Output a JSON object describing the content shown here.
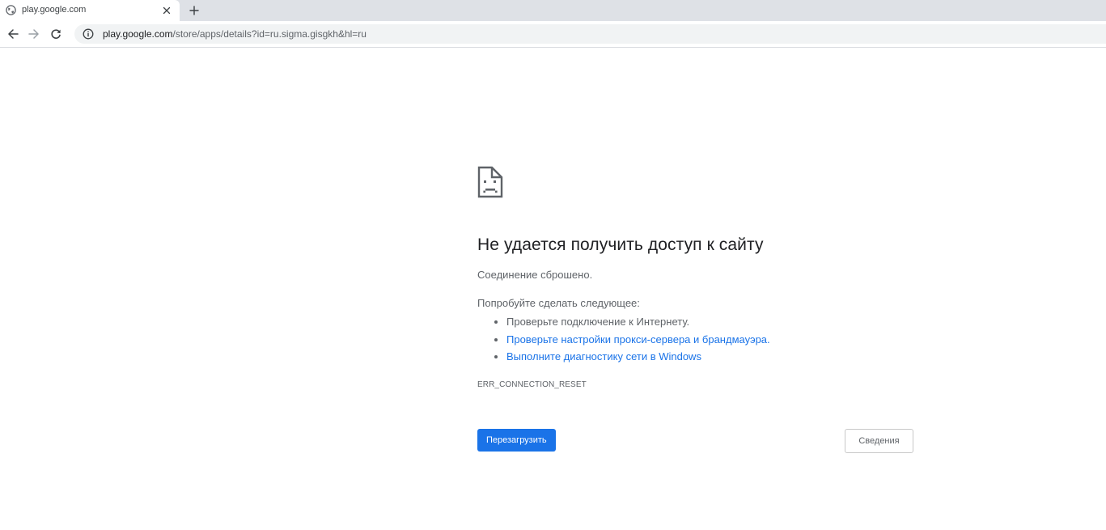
{
  "browser": {
    "tab": {
      "title": "play.google.com",
      "favicon": "globe-icon",
      "close_icon": "close-icon"
    },
    "new_tab_icon": "plus-icon",
    "toolbar": {
      "back_icon": "back-arrow-icon",
      "forward_icon": "forward-arrow-icon",
      "reload_icon": "reload-icon",
      "info_icon": "info-icon",
      "url_host": "play.google.com",
      "url_path": "/store/apps/details?id=ru.sigma.gisgkh&hl=ru"
    }
  },
  "error_page": {
    "icon": "sad-page-icon",
    "title": "Не удается получить доступ к сайту",
    "description": "Соединение сброшено.",
    "try_label": "Попробуйте сделать следующее:",
    "suggestions": [
      {
        "text": "Проверьте подключение к Интернету.",
        "is_link": false
      },
      {
        "text": "Проверьте настройки прокси-сервера и брандмауэра.",
        "is_link": true
      },
      {
        "text": "Выполните диагностику сети в Windows",
        "is_link": true
      }
    ],
    "error_code": "ERR_CONNECTION_RESET",
    "reload_button": "Перезагрузить",
    "details_button": "Сведения"
  },
  "colors": {
    "accent": "#1a73e8",
    "tabstrip_bg": "#dee1e6",
    "omnibox_bg": "#f1f3f4",
    "text_primary": "#202124",
    "text_secondary": "#5f6368"
  }
}
